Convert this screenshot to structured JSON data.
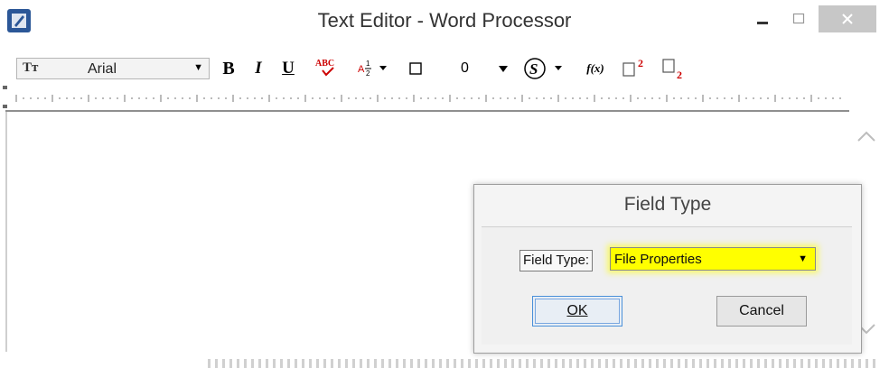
{
  "window": {
    "title": "Text Editor - Word Processor",
    "icons": {
      "app": "pen-document-icon",
      "minimize": "minimize-icon",
      "maximize": "maximize-icon",
      "close": "close-icon"
    }
  },
  "toolbar": {
    "font_name": "Arial",
    "font_size": "0",
    "items": [
      "text-format-icon",
      "bold-icon",
      "italic-icon",
      "underline-icon",
      "spell-check-icon",
      "fraction-icon",
      "box-icon",
      "font-size-dropdown",
      "strikethrough-s-icon",
      "function-icon",
      "superscript-icon",
      "subscript-icon"
    ],
    "labels": {
      "bold": "B",
      "italic": "I",
      "underline": "U",
      "fx": "f(x)",
      "sup": "2",
      "sub": "2",
      "abc": "ABC"
    }
  },
  "dialog": {
    "title": "Field Type",
    "field_label": "Field Type:",
    "field_value": "File Properties",
    "ok_label": "OK",
    "cancel_label": "Cancel"
  },
  "colors": {
    "highlight": "#ffff00",
    "focus_border": "#4a90d9",
    "app_icon": "#2b5797",
    "red_accent": "#cc0000"
  }
}
